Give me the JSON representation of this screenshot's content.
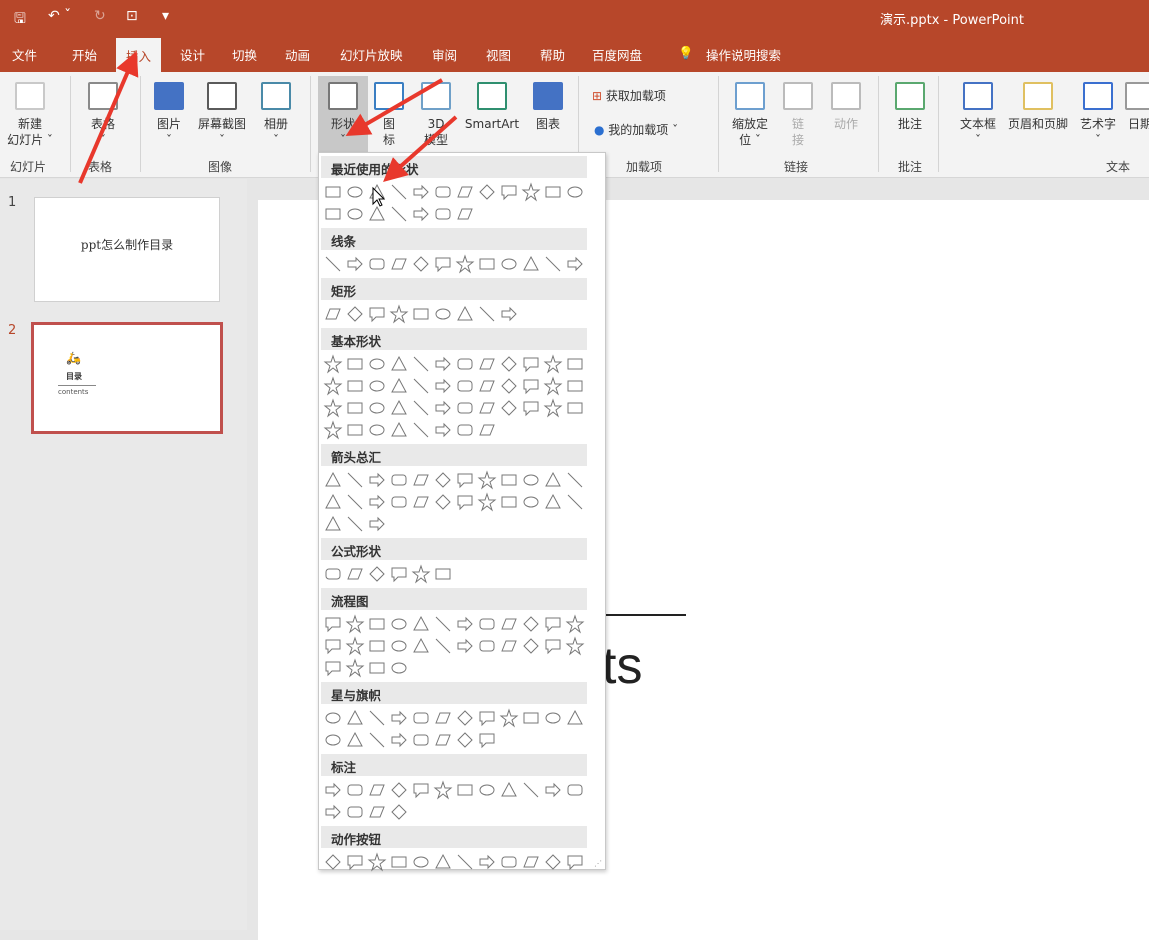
{
  "window": {
    "title": "演示.pptx  -  PowerPoint"
  },
  "qat": {
    "items": [
      "save-icon",
      "undo-icon",
      "redo-icon",
      "present-icon",
      "customize-icon"
    ]
  },
  "tabs": [
    "文件",
    "开始",
    "插入",
    "设计",
    "切换",
    "动画",
    "幻灯片放映",
    "审阅",
    "视图",
    "帮助",
    "百度网盘"
  ],
  "active_tab": "插入",
  "search_label": "操作说明搜索",
  "ribbon": {
    "buttons": [
      {
        "label": "新建\n幻灯片 ˇ",
        "icon": "new-slide-icon"
      },
      {
        "label": "表格\nˇ",
        "icon": "table-icon"
      },
      {
        "label": "图片\nˇ",
        "icon": "picture-icon"
      },
      {
        "label": "屏幕截图\nˇ",
        "icon": "screenshot-icon"
      },
      {
        "label": "相册\nˇ",
        "icon": "photo-album-icon"
      },
      {
        "label": "形状\nˇ",
        "icon": "shapes-icon"
      },
      {
        "label": "图\n标",
        "icon": "icons-icon"
      },
      {
        "label": "3D\n模型",
        "icon": "3d-model-icon"
      },
      {
        "label": "SmartArt",
        "icon": "smartart-icon"
      },
      {
        "label": "图表",
        "icon": "chart-icon"
      },
      {
        "label": "缩放定\n位 ˇ",
        "icon": "zoom-icon"
      },
      {
        "label": "链\n接",
        "icon": "link-icon"
      },
      {
        "label": "动作",
        "icon": "action-icon"
      },
      {
        "label": "批注",
        "icon": "comment-icon"
      },
      {
        "label": "文本框\nˇ",
        "icon": "textbox-icon"
      },
      {
        "label": "页眉和页脚",
        "icon": "header-footer-icon"
      },
      {
        "label": "艺术字\nˇ",
        "icon": "wordart-icon"
      },
      {
        "label": "日期",
        "icon": "date-icon"
      }
    ],
    "addins": {
      "get": "获取加载项",
      "mine": "我的加载项"
    },
    "groups": [
      "幻灯片",
      "表格",
      "图像",
      "加载项",
      "链接",
      "批注",
      "文本"
    ]
  },
  "slides": [
    {
      "num": "1",
      "text": "ppt怎么制作目录"
    },
    {
      "num": "2",
      "title": "目录",
      "subtitle": "contents"
    }
  ],
  "slide_text": "ts",
  "accent": "#b7472a",
  "shapes_menu": {
    "sections": [
      {
        "title": "最近使用的形状",
        "rows": [
          12,
          7
        ]
      },
      {
        "title": "线条",
        "rows": [
          12
        ]
      },
      {
        "title": "矩形",
        "rows": [
          9
        ]
      },
      {
        "title": "基本形状",
        "rows": [
          12,
          12,
          12,
          8
        ]
      },
      {
        "title": "箭头总汇",
        "rows": [
          12,
          12,
          3
        ]
      },
      {
        "title": "公式形状",
        "rows": [
          6
        ]
      },
      {
        "title": "流程图",
        "rows": [
          12,
          12,
          4
        ]
      },
      {
        "title": "星与旗帜",
        "rows": [
          12,
          8
        ]
      },
      {
        "title": "标注",
        "rows": [
          12,
          4
        ]
      },
      {
        "title": "动作按钮",
        "rows": [
          12
        ]
      }
    ]
  }
}
